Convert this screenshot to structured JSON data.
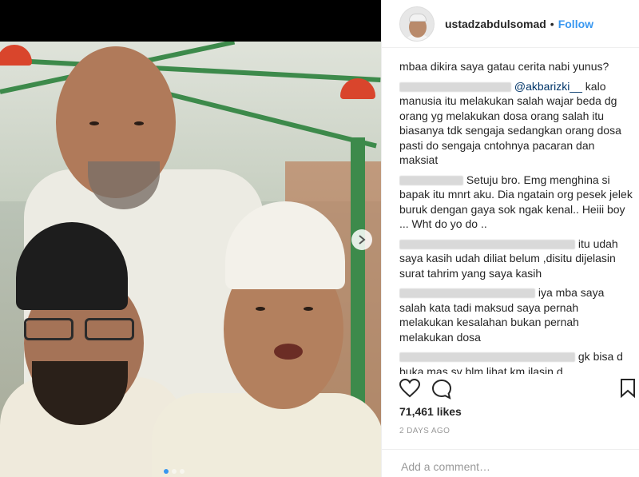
{
  "post": {
    "username": "ustadzabdulsomad",
    "separator": "•",
    "follow_label": "Follow",
    "likes": "71,461 likes",
    "time_ago": "2 DAYS AGO",
    "add_comment_placeholder": "Add a comment…"
  },
  "comments": [
    {
      "text": "mbaa dikira saya gatau cerita nabi yunus?"
    },
    {
      "mention": "@akbarizki__",
      "text": " kalo manusia itu melakukan salah wajar beda dg orang yg melakukan dosa orang salah itu biasanya tdk sengaja sedangkan orang dosa pasti do sengaja cntohnya pacaran dan maksiat"
    },
    {
      "text": "Setuju bro. Emg menghina si bapak itu mnrt aku. Dia ngatain org pesek jelek buruk dengan gaya sok ngak kenal.. Heiii boy ... Wht do yo do .."
    },
    {
      "text": "itu udah saya kasih udah diliat belum ,disitu dijelasin surat tahrim yang saya kasih"
    },
    {
      "text": " iya mba saya salah kata tadi maksud saya pernah melakukan kesalahan bukan pernah melakukan dosa"
    },
    {
      "text": " gk bisa d buka mas sy blm lihat km jlasin d"
    }
  ],
  "icons": {
    "heart": "heart-icon",
    "comment": "comment-icon",
    "save": "bookmark-icon",
    "next": "chevron-right-icon"
  },
  "colors": {
    "follow": "#3897f0",
    "mention": "#003569",
    "muted": "#999999"
  }
}
